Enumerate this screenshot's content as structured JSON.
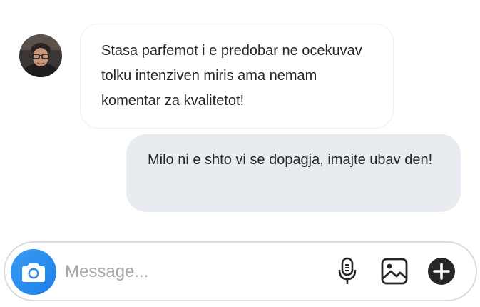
{
  "conversation": {
    "messages": [
      {
        "direction": "incoming",
        "text": "Stasa parfemot i e predobar ne ocekuvav tolku intenziven miris ama nemam komentar za kvalitetot!"
      },
      {
        "direction": "outgoing",
        "text": "Milo ni e shto vi se dopagja, imajte ubav den!"
      }
    ],
    "avatar_icon": "user-photo"
  },
  "composer": {
    "placeholder": "Message...",
    "value": "",
    "camera_icon": "camera-icon",
    "mic_icon": "microphone-icon",
    "gallery_icon": "image-icon",
    "add_icon": "plus-circle-icon"
  },
  "colors": {
    "accent": "#1b7fe8",
    "outgoing_bubble": "#e8ebef",
    "text": "#262626",
    "placeholder": "#a8a8a8"
  }
}
